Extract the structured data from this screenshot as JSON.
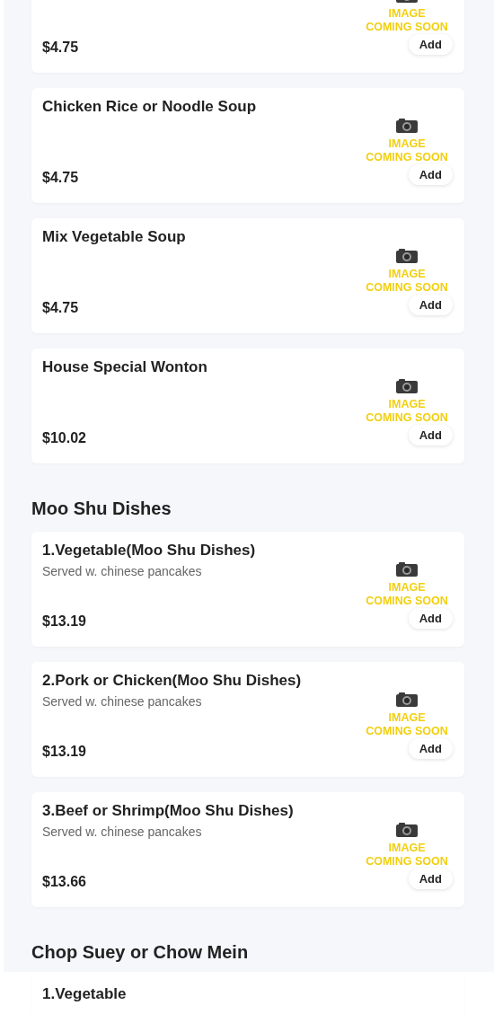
{
  "sections": [
    {
      "items": [
        {
          "price": "$4.75",
          "image_text": "IMAGE COMING SOON",
          "add_label": "Add"
        },
        {
          "name": "Chicken Rice or Noodle Soup",
          "price": "$4.75",
          "image_text": "IMAGE COMING SOON",
          "add_label": "Add"
        },
        {
          "name": "Mix Vegetable Soup",
          "price": "$4.75",
          "image_text": "IMAGE COMING SOON",
          "add_label": "Add"
        },
        {
          "name": "House Special Wonton",
          "price": "$10.02",
          "image_text": "IMAGE COMING SOON",
          "add_label": "Add"
        }
      ]
    },
    {
      "title": "Moo Shu Dishes",
      "items": [
        {
          "name": "1.Vegetable(Moo Shu Dishes)",
          "description": "Served w. chinese pancakes",
          "price": "$13.19",
          "image_text": "IMAGE COMING SOON",
          "add_label": "Add"
        },
        {
          "name": "2.Pork or Chicken(Moo Shu Dishes)",
          "description": "Served w. chinese pancakes",
          "price": "$13.19",
          "image_text": "IMAGE COMING SOON",
          "add_label": "Add"
        },
        {
          "name": "3.Beef or Shrimp(Moo Shu Dishes)",
          "description": "Served w. chinese pancakes",
          "price": "$13.66",
          "image_text": "IMAGE COMING SOON",
          "add_label": "Add"
        }
      ]
    },
    {
      "title": "Chop Suey or Chow Mein",
      "items": [
        {
          "name": "1.Vegetable"
        }
      ]
    }
  ]
}
